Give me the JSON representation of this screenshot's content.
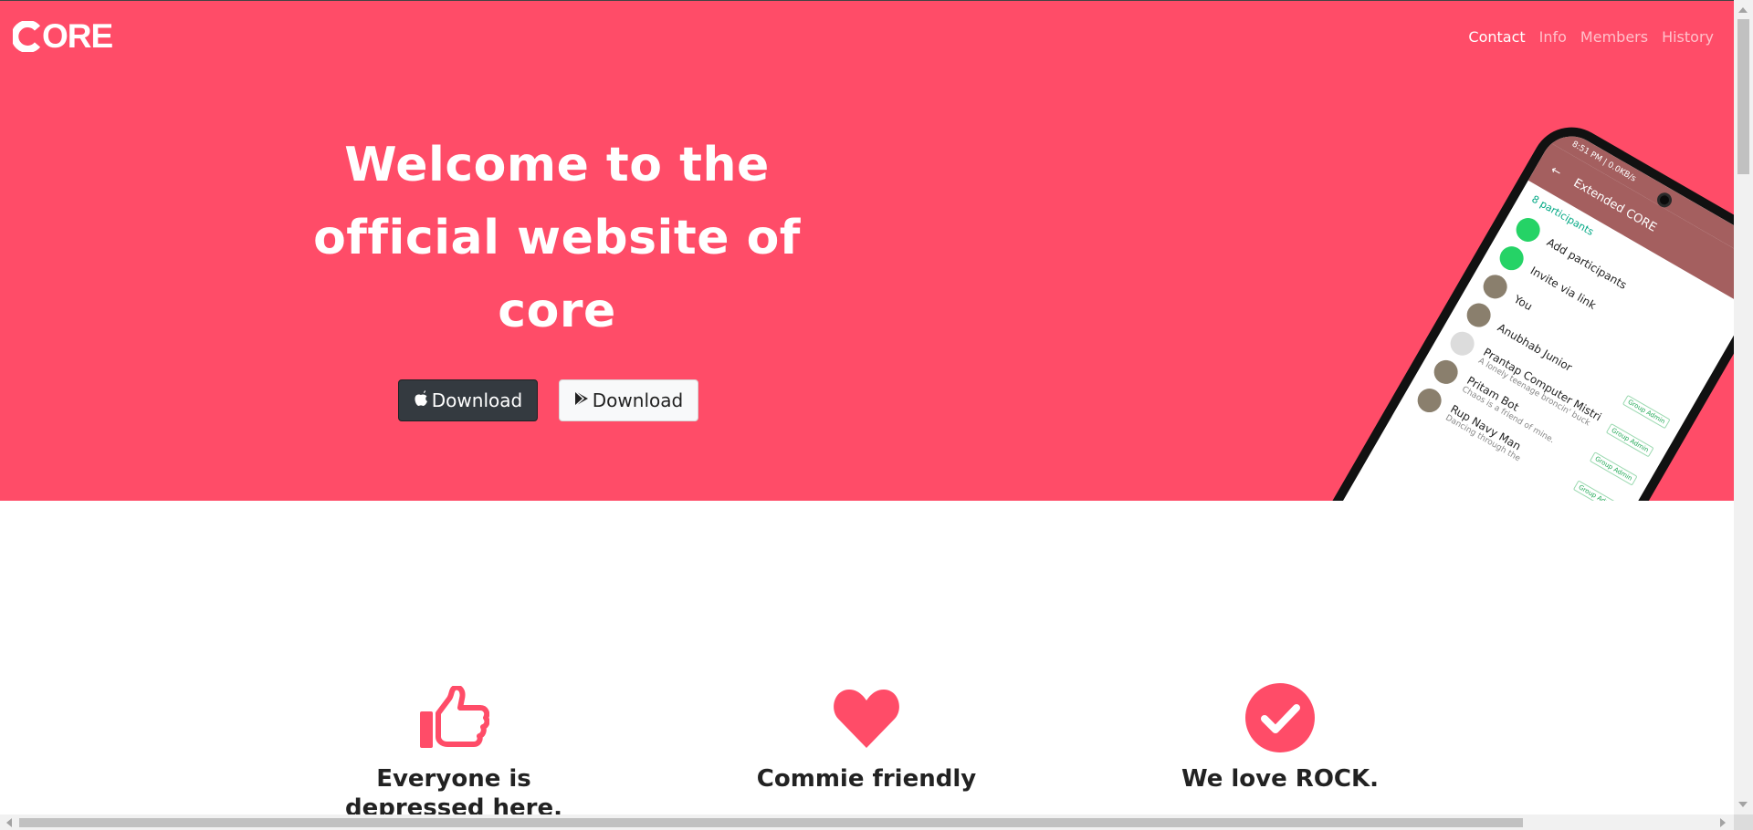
{
  "brand": {
    "logo_text": "ORE"
  },
  "nav": {
    "items": [
      {
        "label": "Contact",
        "active": true
      },
      {
        "label": "Info",
        "active": false
      },
      {
        "label": "Members",
        "active": false
      },
      {
        "label": "History",
        "active": false
      }
    ]
  },
  "hero": {
    "title": "Welcome to the official website of core",
    "apple_button_label": "Download",
    "play_button_label": "Download",
    "background_color": "#ff4c68"
  },
  "phone": {
    "status": "8:51 PM | 0.0KB/s",
    "header_title": "Extended CORE",
    "participants_label": "8 participants",
    "list": [
      {
        "name": "Add participants",
        "sub": "",
        "badge": ""
      },
      {
        "name": "Invite via link",
        "sub": "",
        "badge": ""
      },
      {
        "name": "You",
        "sub": "",
        "badge": ""
      },
      {
        "name": "Anubhab Junior",
        "sub": "",
        "badge": "Group Admin"
      },
      {
        "name": "Prantap Computer Mistri",
        "sub": "A lonely teenage broncin' buck",
        "badge": "Group Admin"
      },
      {
        "name": "Pritam Bot",
        "sub": "Chaos is a friend of mine.",
        "badge": "Group Admin"
      },
      {
        "name": "Rup Navy Man",
        "sub": "Dancing through the",
        "badge": "Group Admin"
      }
    ]
  },
  "features": [
    {
      "title": "Everyone is depressed here.",
      "icon": "thumbs-up-icon"
    },
    {
      "title": "Commie friendly",
      "icon": "heart-icon"
    },
    {
      "title": "We love ROCK.",
      "icon": "check-circle-icon"
    }
  ],
  "colors": {
    "accent": "#ff4c68",
    "dark_button": "#343a40",
    "light_button": "#f8f9fa"
  }
}
